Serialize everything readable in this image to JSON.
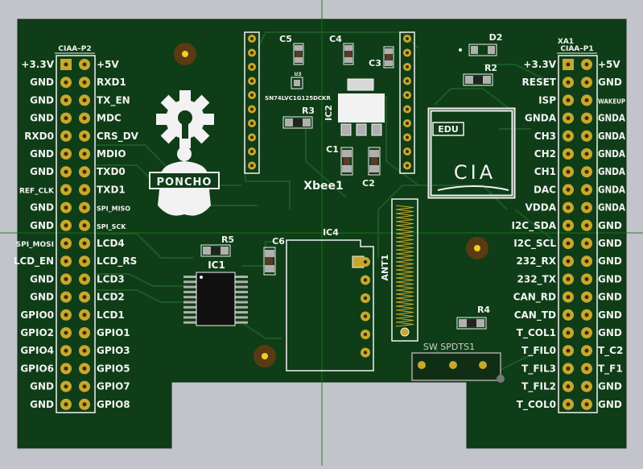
{
  "colors": {
    "background": "#c3c3cc",
    "board": "#0f3d17",
    "trace": "#1c5a26",
    "silkscreen": "#f2f2f2",
    "pad_gold": "#c8a82c",
    "crosshair": "#1b8c1b"
  },
  "header_left": {
    "title": "CIAA–P2",
    "rows": [
      {
        "left": "+3.3V",
        "right": "+5V"
      },
      {
        "left": "GND",
        "right": "RXD1"
      },
      {
        "left": "GND",
        "right": "TX_EN"
      },
      {
        "left": "GND",
        "right": "MDC"
      },
      {
        "left": "RXD0",
        "right": "CRS_DV"
      },
      {
        "left": "GND",
        "right": "MDIO"
      },
      {
        "left": "GND",
        "right": "TXD0"
      },
      {
        "left": "REF_CLK",
        "right": "TXD1"
      },
      {
        "left": "GND",
        "right": "SPI_MISO"
      },
      {
        "left": "GND",
        "right": "SPI_SCK"
      },
      {
        "left": "SPI_MOSI",
        "right": "LCD4"
      },
      {
        "left": "LCD_EN",
        "right": "LCD_RS"
      },
      {
        "left": "GND",
        "right": "LCD3"
      },
      {
        "left": "GND",
        "right": "LCD2"
      },
      {
        "left": "GPIO0",
        "right": "LCD1"
      },
      {
        "left": "GPIO2",
        "right": "GPIO1"
      },
      {
        "left": "GPIO4",
        "right": "GPIO3"
      },
      {
        "left": "GPIO6",
        "right": "GPIO5"
      },
      {
        "left": "GND",
        "right": "GPIO7"
      },
      {
        "left": "GND",
        "right": "GPIO8"
      }
    ]
  },
  "header_right": {
    "ref": "XA1",
    "title": "CIAA–P1",
    "rows": [
      {
        "left": "+3.3V",
        "right": "+5V"
      },
      {
        "left": "RESET",
        "right": "GND"
      },
      {
        "left": "ISP",
        "right": "WAKEUP"
      },
      {
        "left": "GNDA",
        "right": "GNDA"
      },
      {
        "left": "CH3",
        "right": "GNDA"
      },
      {
        "left": "CH2",
        "right": "GNDA"
      },
      {
        "left": "CH1",
        "right": "GNDA"
      },
      {
        "left": "DAC",
        "right": "GNDA"
      },
      {
        "left": "VDDA",
        "right": "GNDA"
      },
      {
        "left": "I2C_SDA",
        "right": "GND"
      },
      {
        "left": "I2C_SCL",
        "right": "GND"
      },
      {
        "left": "232_RX",
        "right": "GND"
      },
      {
        "left": "232_TX",
        "right": "GND"
      },
      {
        "left": "CAN_RD",
        "right": "GND"
      },
      {
        "left": "CAN_TD",
        "right": "GND"
      },
      {
        "left": "T_COL1",
        "right": "GND"
      },
      {
        "left": "T_FIL0",
        "right": "T_C2"
      },
      {
        "left": "T_FIL3",
        "right": "T_F1"
      },
      {
        "left": "T_FIL2",
        "right": "GND"
      },
      {
        "left": "T_COL0",
        "right": "GND"
      }
    ]
  },
  "components": {
    "c5": "C5",
    "c4": "C4",
    "c3": "C3",
    "d2": "D2",
    "r2": "R2",
    "u3": "U3",
    "u3_part": "SN74LVC1G125DCKR",
    "r3": "R3",
    "ic2": "IC2",
    "c1": "C1",
    "c2": "C2",
    "xbee": "Xbee1",
    "r5": "R5",
    "c6": "C6",
    "ic1": "IC1",
    "ic4": "IC4",
    "ant1": "ANT1",
    "r4": "R4",
    "sw": "SW SPDTS1"
  },
  "logos": {
    "poncho": "PONCHO",
    "edu": "EDU",
    "cia": "CIA"
  }
}
